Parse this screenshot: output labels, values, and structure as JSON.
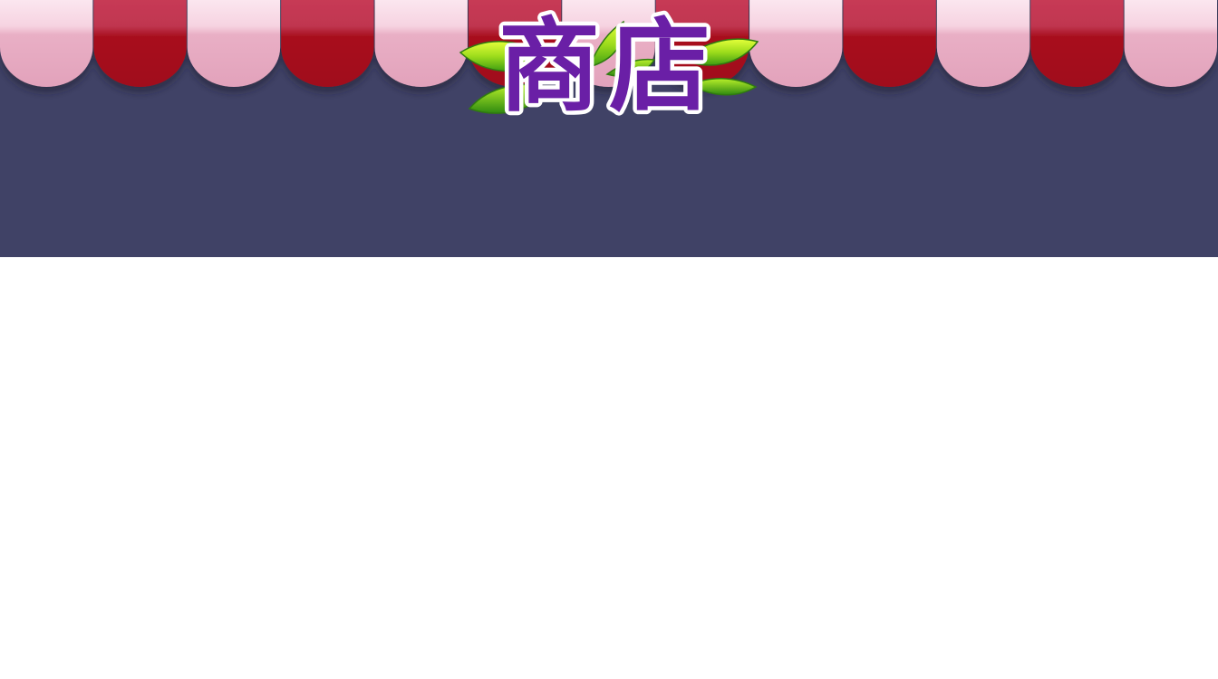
{
  "shop": {
    "title": "商店"
  },
  "colors": {
    "background": "#404266",
    "awning_red": "#a70e1f",
    "awning_pink": "#e6a9c0",
    "title_purple": "#6a1fa6",
    "leaf_green": "#8fd61b"
  },
  "icons": {
    "awning": "striped-awning",
    "leaves": "leaf-decoration"
  }
}
